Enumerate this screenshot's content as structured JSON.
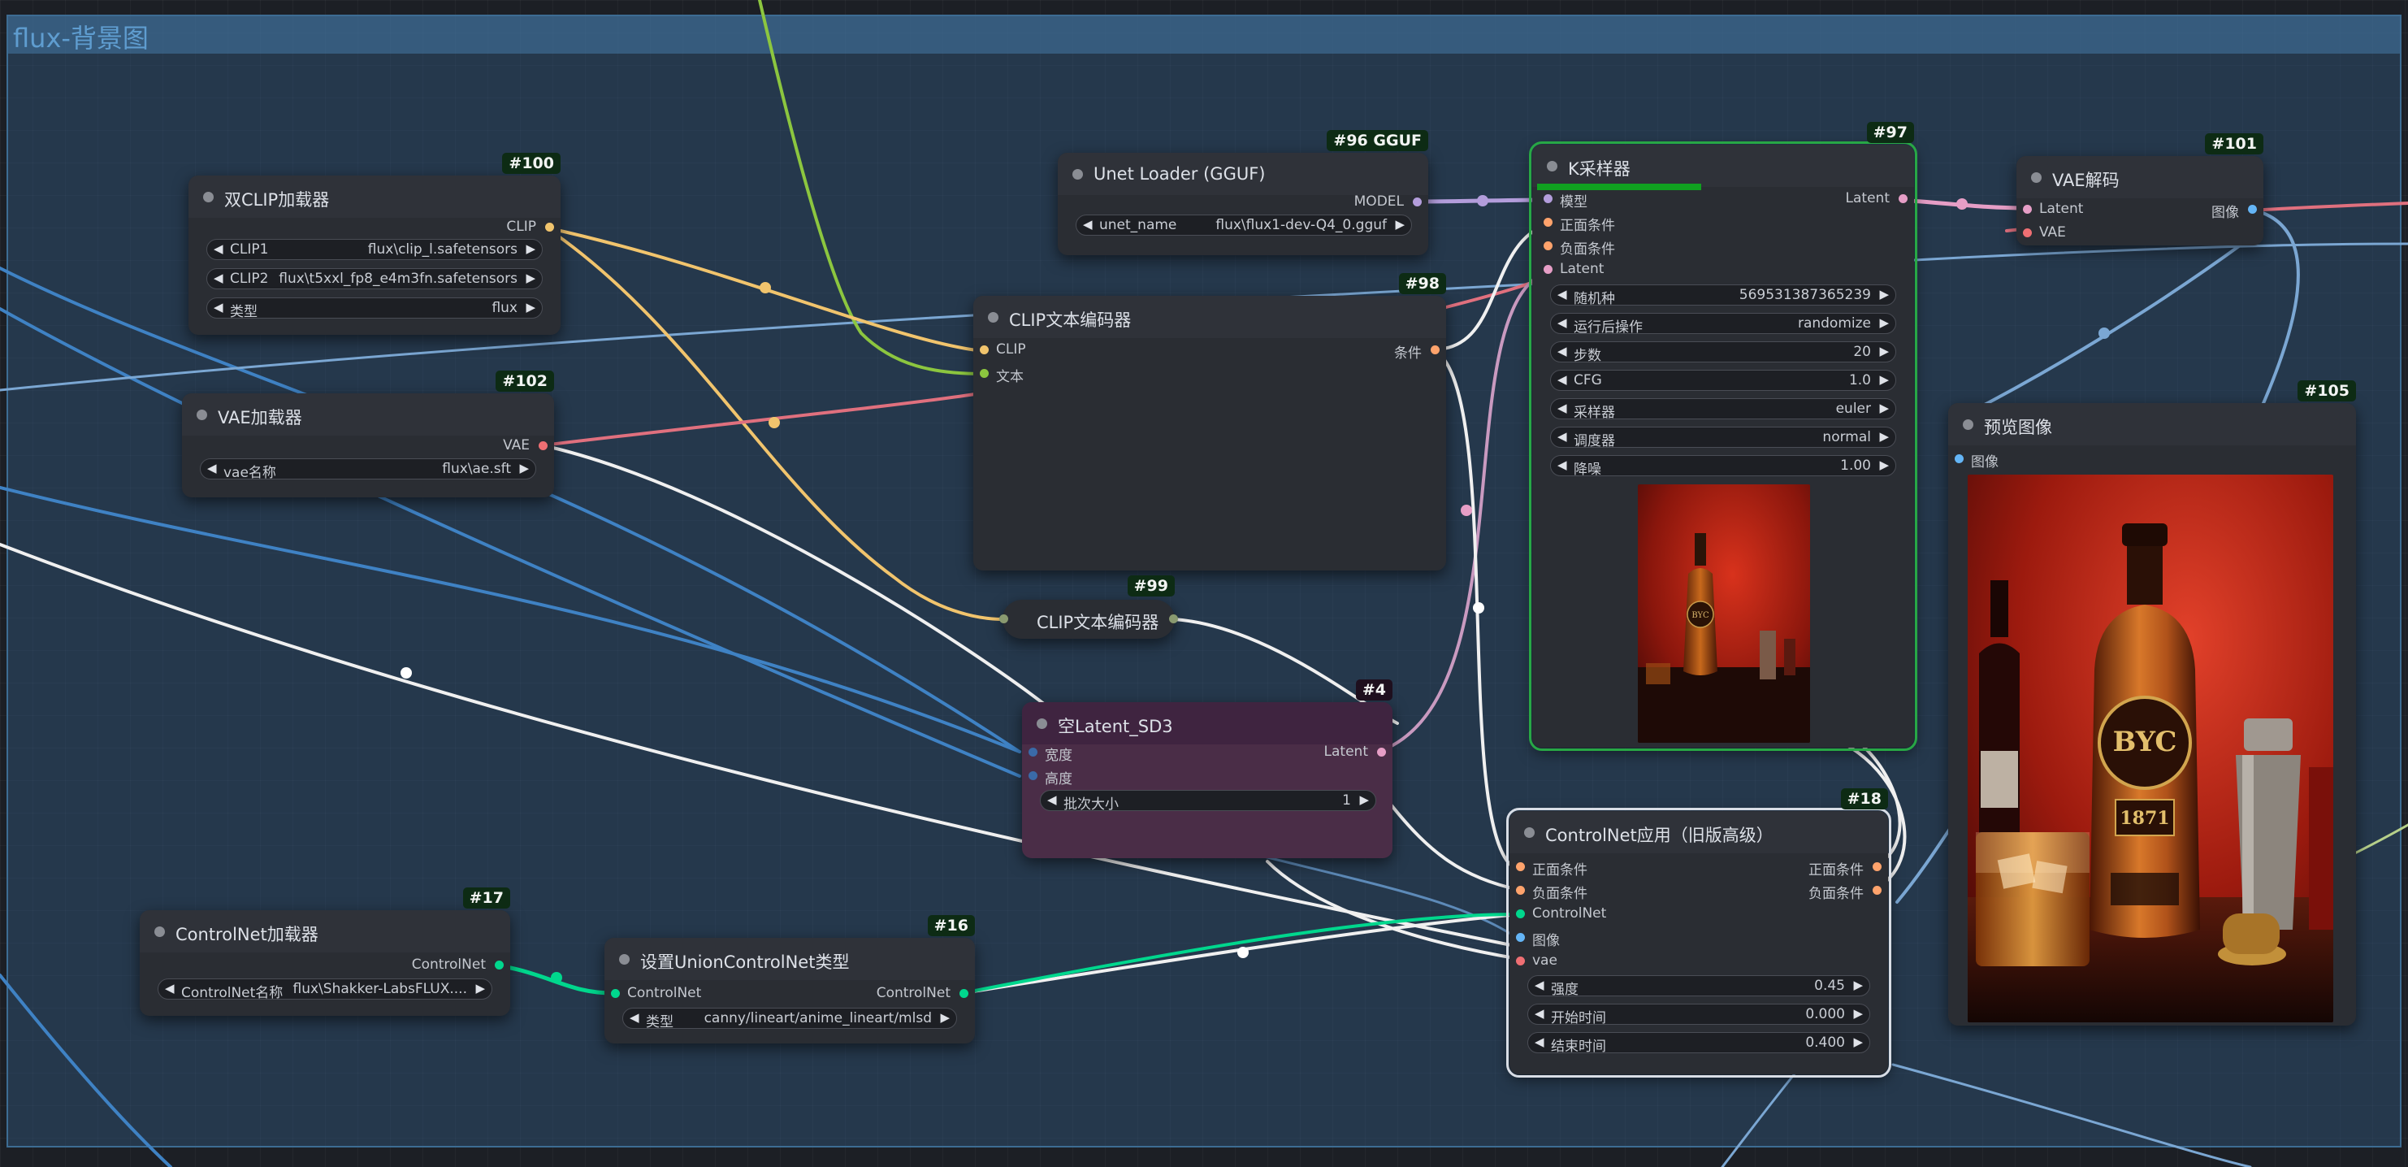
{
  "group": {
    "title": "flux-背景图"
  },
  "colors": {
    "clip": "#f1c46d",
    "vae": "#ef6f73",
    "latent": "#e69ec6",
    "model": "#b39ddb",
    "conditioning": "#ffa36c",
    "controlnet": "#00d78d",
    "image": "#64b5f6",
    "selected": "#28a745"
  },
  "nodes": {
    "dualclip": {
      "id": "#100",
      "title": "双CLIP加载器",
      "out_clip": "CLIP",
      "w1_label": "CLIP1",
      "w1_value": "flux\\clip_l.safetensors",
      "w2_label": "CLIP2",
      "w2_value": "flux\\t5xxl_fp8_e4m3fn.safetensors",
      "w3_label": "类型",
      "w3_value": "flux"
    },
    "vaeloader": {
      "id": "#102",
      "title": "VAE加载器",
      "out_vae": "VAE",
      "w1_label": "vae名称",
      "w1_value": "flux\\ae.sft"
    },
    "unet": {
      "id": "#96 GGUF",
      "title": "Unet Loader (GGUF)",
      "out_model": "MODEL",
      "w1_label": "unet_name",
      "w1_value": "flux\\flux1-dev-Q4_0.gguf"
    },
    "clipenc98": {
      "id": "#98",
      "title": "CLIP文本编码器",
      "in_clip": "CLIP",
      "in_text": "文本",
      "out_cond": "条件"
    },
    "clipenc99": {
      "id": "#99",
      "title": "CLIP文本编码器"
    },
    "ksampler": {
      "id": "#97",
      "title": "K采样器",
      "progress": 0.44,
      "in_model": "模型",
      "in_pos": "正面条件",
      "in_neg": "负面条件",
      "in_latent": "Latent",
      "out_latent": "Latent",
      "widgets": [
        {
          "label": "随机种",
          "value": "569531387365239"
        },
        {
          "label": "运行后操作",
          "value": "randomize"
        },
        {
          "label": "步数",
          "value": "20"
        },
        {
          "label": "CFG",
          "value": "1.0"
        },
        {
          "label": "采样器",
          "value": "euler"
        },
        {
          "label": "调度器",
          "value": "normal"
        },
        {
          "label": "降噪",
          "value": "1.00"
        }
      ]
    },
    "vaedecode": {
      "id": "#101",
      "title": "VAE解码",
      "in_latent": "Latent",
      "in_vae": "VAE",
      "out_image": "图像"
    },
    "preview": {
      "id": "#105",
      "title": "预览图像",
      "in_image": "图像"
    },
    "emptylatent": {
      "id": "#4",
      "title": "空Latent_SD3",
      "in_w": "宽度",
      "in_h": "高度",
      "out_latent": "Latent",
      "w1_label": "批次大小",
      "w1_value": "1"
    },
    "cnapply": {
      "id": "#18",
      "title": "ControlNet应用（旧版高级）",
      "in_pos": "正面条件",
      "in_neg": "负面条件",
      "in_cn": "ControlNet",
      "in_img": "图像",
      "in_vae": "vae",
      "out_pos": "正面条件",
      "out_neg": "负面条件",
      "widgets": [
        {
          "label": "强度",
          "value": "0.45"
        },
        {
          "label": "开始时间",
          "value": "0.000"
        },
        {
          "label": "结束时间",
          "value": "0.400"
        }
      ]
    },
    "cnloader": {
      "id": "#17",
      "title": "ControlNet加载器",
      "out_cn": "ControlNet",
      "w1_label": "ControlNet名称",
      "w1_value": "flux\\Shakker-LabsFLUX...."
    },
    "unioncn": {
      "id": "#16",
      "title": "设置UnionControlNet类型",
      "in_cn": "ControlNet",
      "out_cn": "ControlNet",
      "w1_label": "类型",
      "w1_value": "canny/lineart/anime_lineart/mlsd"
    }
  },
  "image_text": {
    "brand": "BYC",
    "year": "1871"
  }
}
